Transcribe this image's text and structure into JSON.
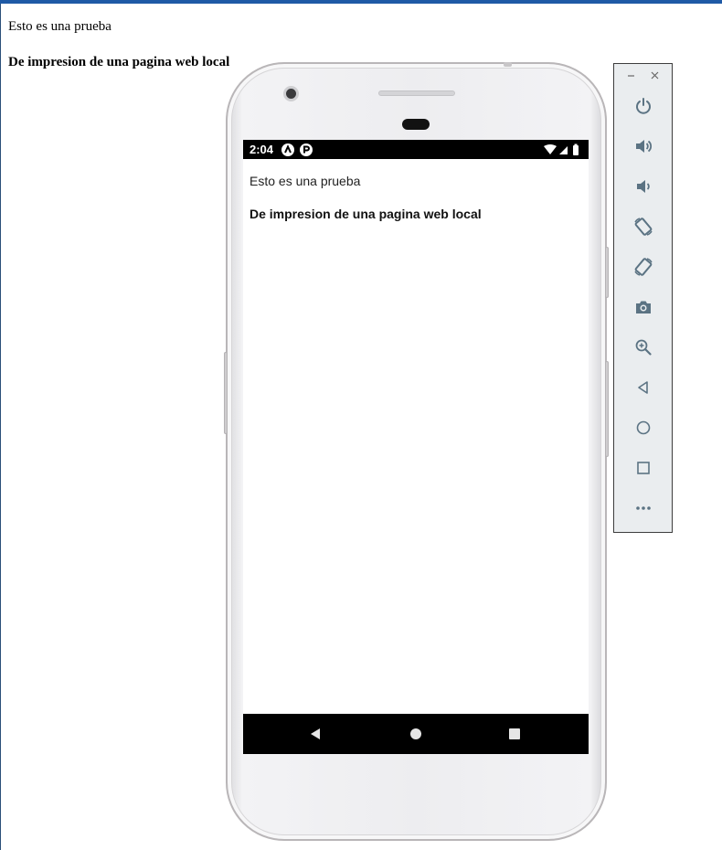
{
  "host_page": {
    "line_1": "Esto es una prueba",
    "line_2": "De impresion de una pagina web local"
  },
  "emulator": {
    "status_bar": {
      "time": "2:04",
      "app_icons": [
        "a-icon",
        "p-icon"
      ],
      "right_icons": [
        "wifi-icon",
        "signal-icon",
        "battery-icon"
      ]
    },
    "app_content": {
      "line_1": "Esto es una prueba",
      "line_2": "De impresion de una pagina web local"
    },
    "nav_bar": [
      "back-icon",
      "home-icon",
      "recents-icon"
    ]
  },
  "toolbar": {
    "window_controls": [
      "minimize-icon",
      "close-icon"
    ],
    "buttons": [
      "power-icon",
      "volume-up-icon",
      "volume-down-icon",
      "rotate-left-icon",
      "rotate-right-icon",
      "camera-icon",
      "zoom-icon",
      "back-icon",
      "home-icon",
      "overview-icon",
      "more-icon"
    ]
  },
  "colors": {
    "accent_bar": "#1f5aa6",
    "toolbar_icon": "#5b7383",
    "phone_bezel": "#ededf0"
  }
}
